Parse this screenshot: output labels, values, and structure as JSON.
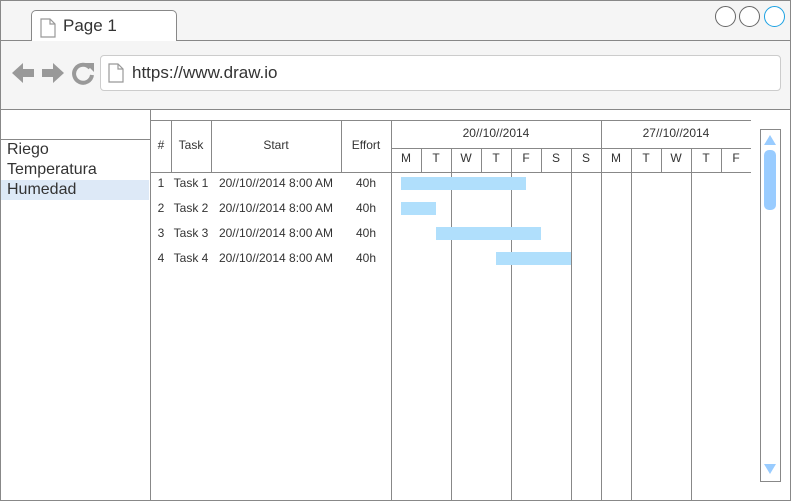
{
  "browser": {
    "tab_title": "Page 1",
    "url": "https://www.draw.io",
    "icons": {
      "back": "left-arrow-icon",
      "forward": "right-arrow-icon",
      "reload": "reload-icon",
      "page": "page-icon"
    },
    "accent_color": "#1ba1e2"
  },
  "sidebar": {
    "items": [
      {
        "label": "Riego",
        "selected": false
      },
      {
        "label": "Temperatura",
        "selected": false
      },
      {
        "label": "Humedad",
        "selected": true
      }
    ],
    "selected_color": "#dde9f7"
  },
  "gantt": {
    "columns": [
      "#",
      "Task",
      "Start",
      "Effort"
    ],
    "weeks": [
      {
        "label": "20//10//2014",
        "days": [
          "M",
          "T",
          "W",
          "T",
          "F",
          "S",
          "S"
        ]
      },
      {
        "label": "27//10//2014",
        "days": [
          "M",
          "T",
          "W",
          "T",
          "F"
        ]
      }
    ],
    "rows": [
      {
        "num": "1",
        "task": "Task 1",
        "start": "20//10//2014 8:00 AM",
        "effort": "40h",
        "bar_start_day": 0,
        "bar_days": 4.5
      },
      {
        "num": "2",
        "task": "Task 2",
        "start": "20//10//2014 8:00 AM",
        "effort": "40h",
        "bar_start_day": 0,
        "bar_days": 1.5
      },
      {
        "num": "3",
        "task": "Task 3",
        "start": "20//10//2014 8:00 AM",
        "effort": "40h",
        "bar_start_day": 1.5,
        "bar_days": 3.5
      },
      {
        "num": "4",
        "task": "Task 4",
        "start": "20//10//2014 8:00 AM",
        "effort": "40h",
        "bar_start_day": 3.5,
        "bar_days": 2.5
      }
    ],
    "bar_color": "#b0dffc"
  }
}
